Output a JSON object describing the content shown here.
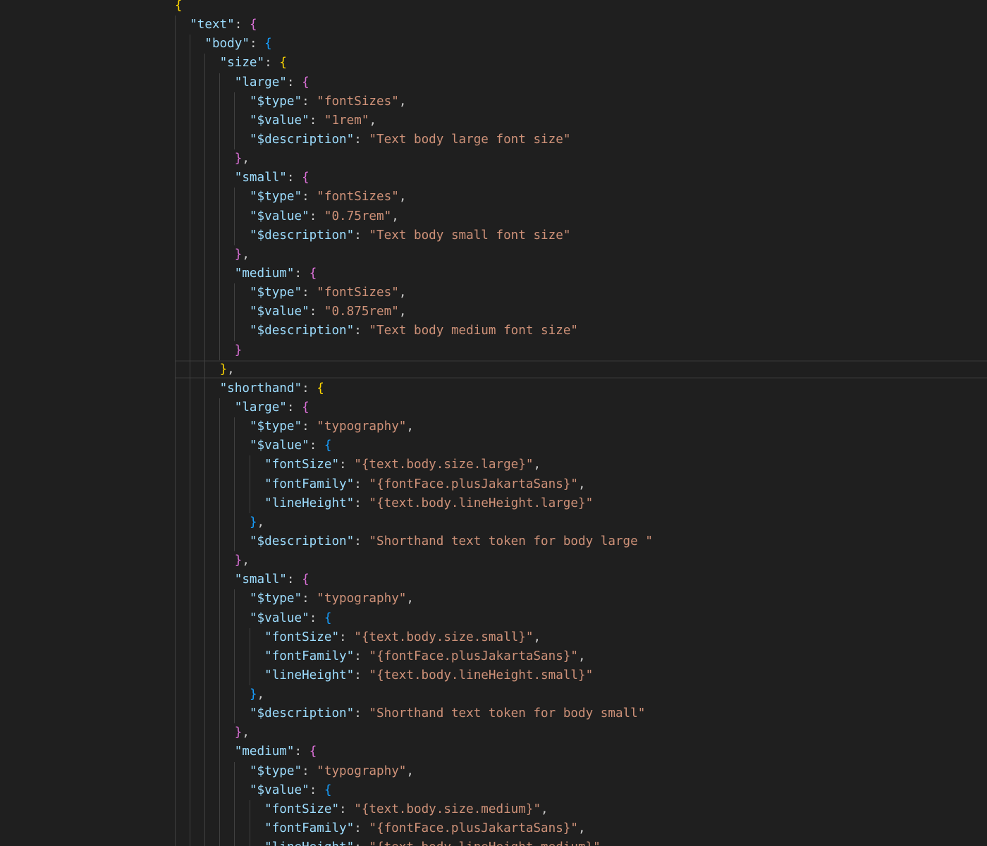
{
  "editor": {
    "language": "json",
    "colors": {
      "background": "#1f1f1f",
      "key": "#9cdcfe",
      "string": "#ce9178",
      "punctuation": "#cccccc",
      "bracket_level_1": "#ffd700",
      "bracket_level_2": "#da70d6",
      "bracket_level_3": "#179fff",
      "indent_guide": "#404040"
    },
    "lines": [
      {
        "indent": 0,
        "tokens": [
          {
            "t": "{",
            "c": "b1"
          }
        ]
      },
      {
        "indent": 1,
        "tokens": [
          {
            "t": "\"text\"",
            "c": "k"
          },
          {
            "t": ": ",
            "c": "p"
          },
          {
            "t": "{",
            "c": "b2"
          }
        ]
      },
      {
        "indent": 2,
        "tokens": [
          {
            "t": "\"body\"",
            "c": "k"
          },
          {
            "t": ": ",
            "c": "p"
          },
          {
            "t": "{",
            "c": "b3"
          }
        ]
      },
      {
        "indent": 3,
        "tokens": [
          {
            "t": "\"size\"",
            "c": "k"
          },
          {
            "t": ": ",
            "c": "p"
          },
          {
            "t": "{",
            "c": "b1"
          }
        ]
      },
      {
        "indent": 4,
        "tokens": [
          {
            "t": "\"large\"",
            "c": "k"
          },
          {
            "t": ": ",
            "c": "p"
          },
          {
            "t": "{",
            "c": "b2"
          }
        ]
      },
      {
        "indent": 5,
        "tokens": [
          {
            "t": "\"$type\"",
            "c": "k"
          },
          {
            "t": ": ",
            "c": "p"
          },
          {
            "t": "\"fontSizes\"",
            "c": "s"
          },
          {
            "t": ",",
            "c": "p"
          }
        ]
      },
      {
        "indent": 5,
        "tokens": [
          {
            "t": "\"$value\"",
            "c": "k"
          },
          {
            "t": ": ",
            "c": "p"
          },
          {
            "t": "\"1rem\"",
            "c": "s"
          },
          {
            "t": ",",
            "c": "p"
          }
        ]
      },
      {
        "indent": 5,
        "tokens": [
          {
            "t": "\"$description\"",
            "c": "k"
          },
          {
            "t": ": ",
            "c": "p"
          },
          {
            "t": "\"Text body large font size\"",
            "c": "s"
          }
        ]
      },
      {
        "indent": 4,
        "tokens": [
          {
            "t": "}",
            "c": "b2"
          },
          {
            "t": ",",
            "c": "p"
          }
        ]
      },
      {
        "indent": 4,
        "tokens": [
          {
            "t": "\"small\"",
            "c": "k"
          },
          {
            "t": ": ",
            "c": "p"
          },
          {
            "t": "{",
            "c": "b2"
          }
        ]
      },
      {
        "indent": 5,
        "tokens": [
          {
            "t": "\"$type\"",
            "c": "k"
          },
          {
            "t": ": ",
            "c": "p"
          },
          {
            "t": "\"fontSizes\"",
            "c": "s"
          },
          {
            "t": ",",
            "c": "p"
          }
        ]
      },
      {
        "indent": 5,
        "tokens": [
          {
            "t": "\"$value\"",
            "c": "k"
          },
          {
            "t": ": ",
            "c": "p"
          },
          {
            "t": "\"0.75rem\"",
            "c": "s"
          },
          {
            "t": ",",
            "c": "p"
          }
        ]
      },
      {
        "indent": 5,
        "tokens": [
          {
            "t": "\"$description\"",
            "c": "k"
          },
          {
            "t": ": ",
            "c": "p"
          },
          {
            "t": "\"Text body small font size\"",
            "c": "s"
          }
        ]
      },
      {
        "indent": 4,
        "tokens": [
          {
            "t": "}",
            "c": "b2"
          },
          {
            "t": ",",
            "c": "p"
          }
        ]
      },
      {
        "indent": 4,
        "tokens": [
          {
            "t": "\"medium\"",
            "c": "k"
          },
          {
            "t": ": ",
            "c": "p"
          },
          {
            "t": "{",
            "c": "b2"
          }
        ]
      },
      {
        "indent": 5,
        "tokens": [
          {
            "t": "\"$type\"",
            "c": "k"
          },
          {
            "t": ": ",
            "c": "p"
          },
          {
            "t": "\"fontSizes\"",
            "c": "s"
          },
          {
            "t": ",",
            "c": "p"
          }
        ]
      },
      {
        "indent": 5,
        "tokens": [
          {
            "t": "\"$value\"",
            "c": "k"
          },
          {
            "t": ": ",
            "c": "p"
          },
          {
            "t": "\"0.875rem\"",
            "c": "s"
          },
          {
            "t": ",",
            "c": "p"
          }
        ]
      },
      {
        "indent": 5,
        "tokens": [
          {
            "t": "\"$description\"",
            "c": "k"
          },
          {
            "t": ": ",
            "c": "p"
          },
          {
            "t": "\"Text body medium font size\"",
            "c": "s"
          }
        ]
      },
      {
        "indent": 4,
        "tokens": [
          {
            "t": "}",
            "c": "b2"
          }
        ]
      },
      {
        "indent": 3,
        "tokens": [
          {
            "t": "}",
            "c": "b1"
          },
          {
            "t": ",",
            "c": "p"
          }
        ]
      },
      {
        "indent": 3,
        "tokens": [
          {
            "t": "\"shorthand\"",
            "c": "k"
          },
          {
            "t": ": ",
            "c": "p"
          },
          {
            "t": "{",
            "c": "b1"
          }
        ]
      },
      {
        "indent": 4,
        "tokens": [
          {
            "t": "\"large\"",
            "c": "k"
          },
          {
            "t": ": ",
            "c": "p"
          },
          {
            "t": "{",
            "c": "b2"
          }
        ]
      },
      {
        "indent": 5,
        "tokens": [
          {
            "t": "\"$type\"",
            "c": "k"
          },
          {
            "t": ": ",
            "c": "p"
          },
          {
            "t": "\"typography\"",
            "c": "s"
          },
          {
            "t": ",",
            "c": "p"
          }
        ]
      },
      {
        "indent": 5,
        "tokens": [
          {
            "t": "\"$value\"",
            "c": "k"
          },
          {
            "t": ": ",
            "c": "p"
          },
          {
            "t": "{",
            "c": "b3"
          }
        ]
      },
      {
        "indent": 6,
        "tokens": [
          {
            "t": "\"fontSize\"",
            "c": "k"
          },
          {
            "t": ": ",
            "c": "p"
          },
          {
            "t": "\"{text.body.size.large}\"",
            "c": "s"
          },
          {
            "t": ",",
            "c": "p"
          }
        ]
      },
      {
        "indent": 6,
        "tokens": [
          {
            "t": "\"fontFamily\"",
            "c": "k"
          },
          {
            "t": ": ",
            "c": "p"
          },
          {
            "t": "\"{fontFace.plusJakartaSans}\"",
            "c": "s"
          },
          {
            "t": ",",
            "c": "p"
          }
        ]
      },
      {
        "indent": 6,
        "tokens": [
          {
            "t": "\"lineHeight\"",
            "c": "k"
          },
          {
            "t": ": ",
            "c": "p"
          },
          {
            "t": "\"{text.body.lineHeight.large}\"",
            "c": "s"
          }
        ]
      },
      {
        "indent": 5,
        "tokens": [
          {
            "t": "}",
            "c": "b3"
          },
          {
            "t": ",",
            "c": "p"
          }
        ]
      },
      {
        "indent": 5,
        "tokens": [
          {
            "t": "\"$description\"",
            "c": "k"
          },
          {
            "t": ": ",
            "c": "p"
          },
          {
            "t": "\"Shorthand text token for body large \"",
            "c": "s"
          }
        ]
      },
      {
        "indent": 4,
        "tokens": [
          {
            "t": "}",
            "c": "b2"
          },
          {
            "t": ",",
            "c": "p"
          }
        ]
      },
      {
        "indent": 4,
        "tokens": [
          {
            "t": "\"small\"",
            "c": "k"
          },
          {
            "t": ": ",
            "c": "p"
          },
          {
            "t": "{",
            "c": "b2"
          }
        ]
      },
      {
        "indent": 5,
        "tokens": [
          {
            "t": "\"$type\"",
            "c": "k"
          },
          {
            "t": ": ",
            "c": "p"
          },
          {
            "t": "\"typography\"",
            "c": "s"
          },
          {
            "t": ",",
            "c": "p"
          }
        ]
      },
      {
        "indent": 5,
        "tokens": [
          {
            "t": "\"$value\"",
            "c": "k"
          },
          {
            "t": ": ",
            "c": "p"
          },
          {
            "t": "{",
            "c": "b3"
          }
        ]
      },
      {
        "indent": 6,
        "tokens": [
          {
            "t": "\"fontSize\"",
            "c": "k"
          },
          {
            "t": ": ",
            "c": "p"
          },
          {
            "t": "\"{text.body.size.small}\"",
            "c": "s"
          },
          {
            "t": ",",
            "c": "p"
          }
        ]
      },
      {
        "indent": 6,
        "tokens": [
          {
            "t": "\"fontFamily\"",
            "c": "k"
          },
          {
            "t": ": ",
            "c": "p"
          },
          {
            "t": "\"{fontFace.plusJakartaSans}\"",
            "c": "s"
          },
          {
            "t": ",",
            "c": "p"
          }
        ]
      },
      {
        "indent": 6,
        "tokens": [
          {
            "t": "\"lineHeight\"",
            "c": "k"
          },
          {
            "t": ": ",
            "c": "p"
          },
          {
            "t": "\"{text.body.lineHeight.small}\"",
            "c": "s"
          }
        ]
      },
      {
        "indent": 5,
        "tokens": [
          {
            "t": "}",
            "c": "b3"
          },
          {
            "t": ",",
            "c": "p"
          }
        ]
      },
      {
        "indent": 5,
        "tokens": [
          {
            "t": "\"$description\"",
            "c": "k"
          },
          {
            "t": ": ",
            "c": "p"
          },
          {
            "t": "\"Shorthand text token for body small\"",
            "c": "s"
          }
        ]
      },
      {
        "indent": 4,
        "tokens": [
          {
            "t": "}",
            "c": "b2"
          },
          {
            "t": ",",
            "c": "p"
          }
        ]
      },
      {
        "indent": 4,
        "tokens": [
          {
            "t": "\"medium\"",
            "c": "k"
          },
          {
            "t": ": ",
            "c": "p"
          },
          {
            "t": "{",
            "c": "b2"
          }
        ]
      },
      {
        "indent": 5,
        "tokens": [
          {
            "t": "\"$type\"",
            "c": "k"
          },
          {
            "t": ": ",
            "c": "p"
          },
          {
            "t": "\"typography\"",
            "c": "s"
          },
          {
            "t": ",",
            "c": "p"
          }
        ]
      },
      {
        "indent": 5,
        "tokens": [
          {
            "t": "\"$value\"",
            "c": "k"
          },
          {
            "t": ": ",
            "c": "p"
          },
          {
            "t": "{",
            "c": "b3"
          }
        ]
      },
      {
        "indent": 6,
        "tokens": [
          {
            "t": "\"fontSize\"",
            "c": "k"
          },
          {
            "t": ": ",
            "c": "p"
          },
          {
            "t": "\"{text.body.size.medium}\"",
            "c": "s"
          },
          {
            "t": ",",
            "c": "p"
          }
        ]
      },
      {
        "indent": 6,
        "tokens": [
          {
            "t": "\"fontFamily\"",
            "c": "k"
          },
          {
            "t": ": ",
            "c": "p"
          },
          {
            "t": "\"{fontFace.plusJakartaSans}\"",
            "c": "s"
          },
          {
            "t": ",",
            "c": "p"
          }
        ]
      },
      {
        "indent": 6,
        "tokens": [
          {
            "t": "\"lineHeight\"",
            "c": "k"
          },
          {
            "t": ": ",
            "c": "p"
          },
          {
            "t": "\"{text.body.lineHeight.medium}\"",
            "c": "s"
          }
        ]
      }
    ]
  }
}
